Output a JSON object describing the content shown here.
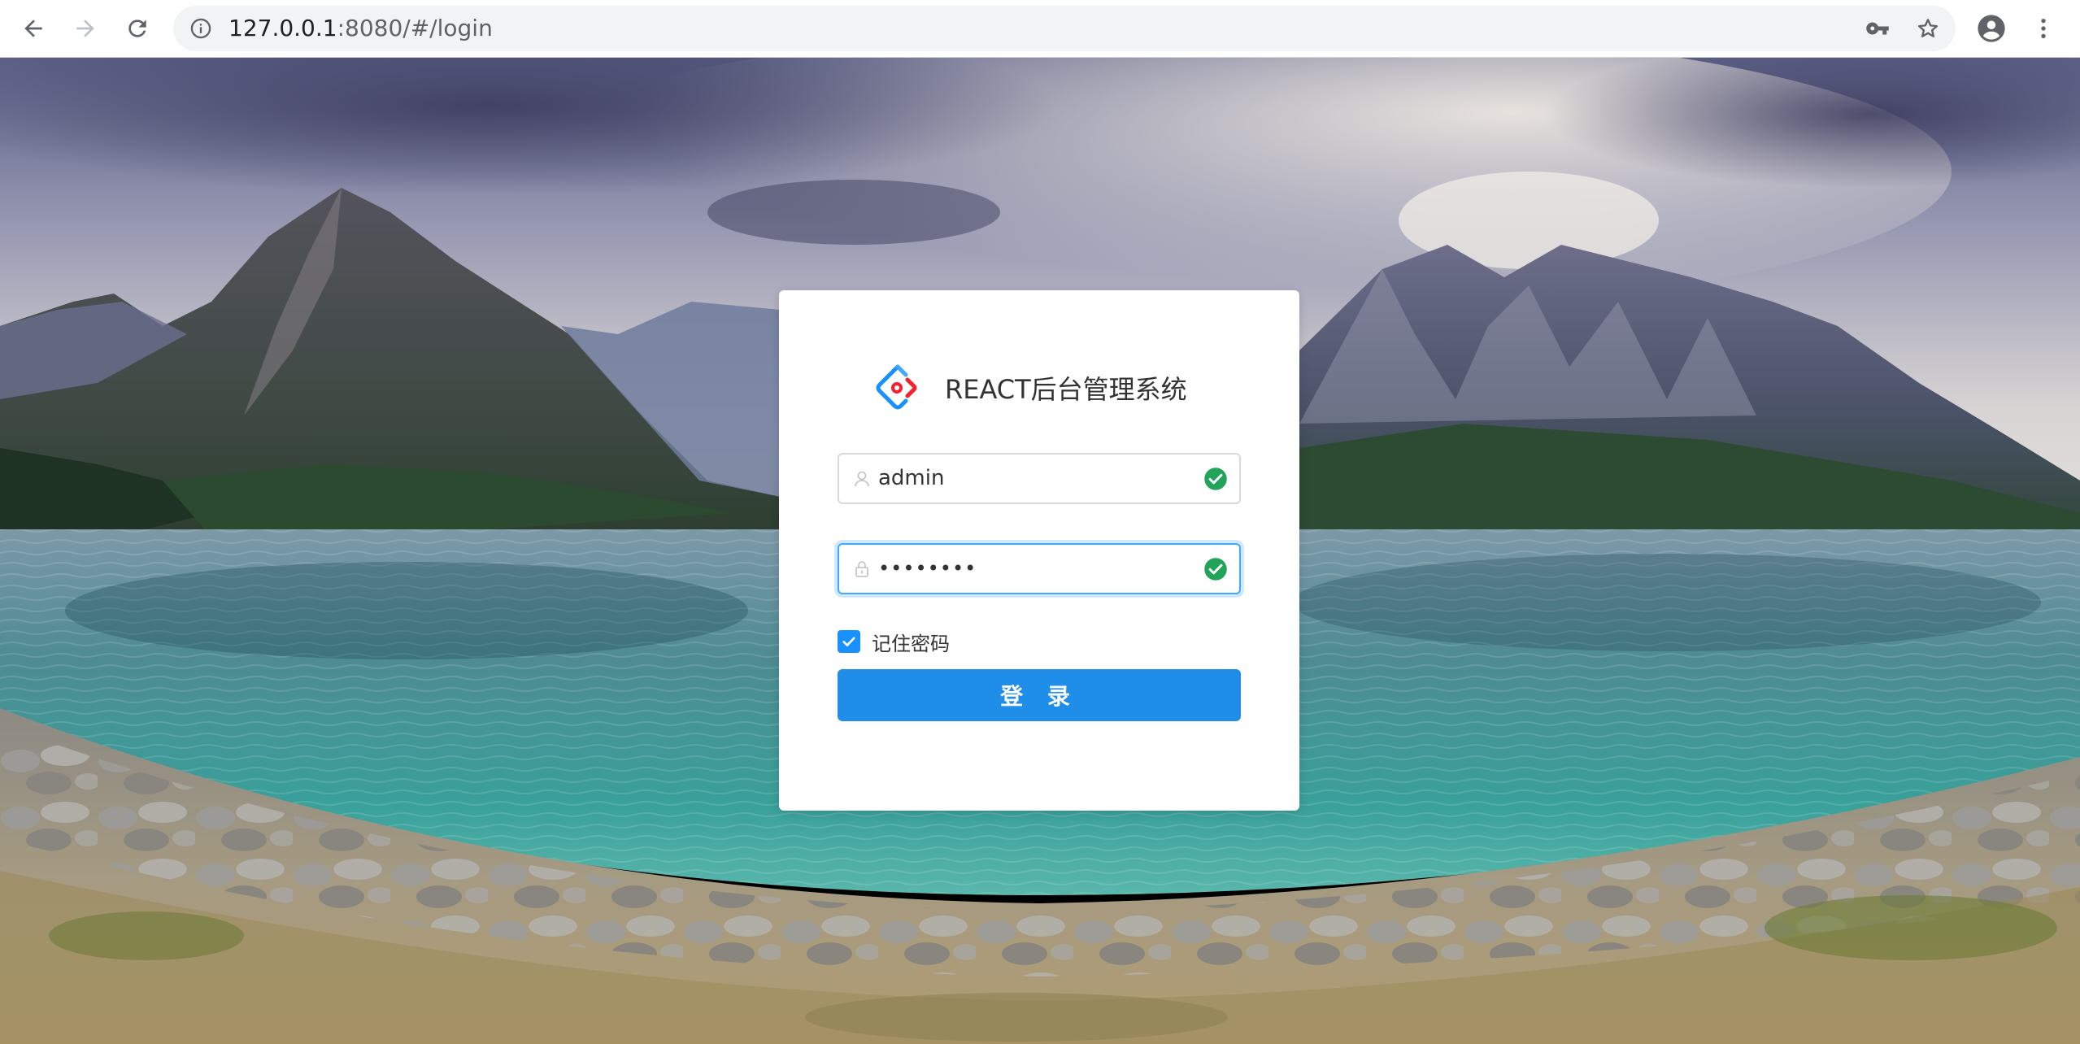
{
  "browser": {
    "url_host": "127.0.0.1",
    "url_rest": ":8080/#/login",
    "icons": {
      "back": "arrow-left-icon",
      "forward": "arrow-right-icon",
      "reload": "reload-icon",
      "info": "info-icon",
      "key": "key-icon",
      "star": "star-icon",
      "avatar": "account-circle-icon",
      "menu": "more-vert-icon"
    }
  },
  "login": {
    "title": "REACT后台管理系统",
    "username_value": "admin",
    "password_value": "••••••••",
    "remember_label": "记住密码",
    "remember_checked": true,
    "submit_label": "登 录"
  },
  "colors": {
    "primary": "#1890ff",
    "button": "#1e8ee9",
    "success": "#21a35a",
    "logo_blue": "#1890ff",
    "logo_red": "#f5222d"
  }
}
